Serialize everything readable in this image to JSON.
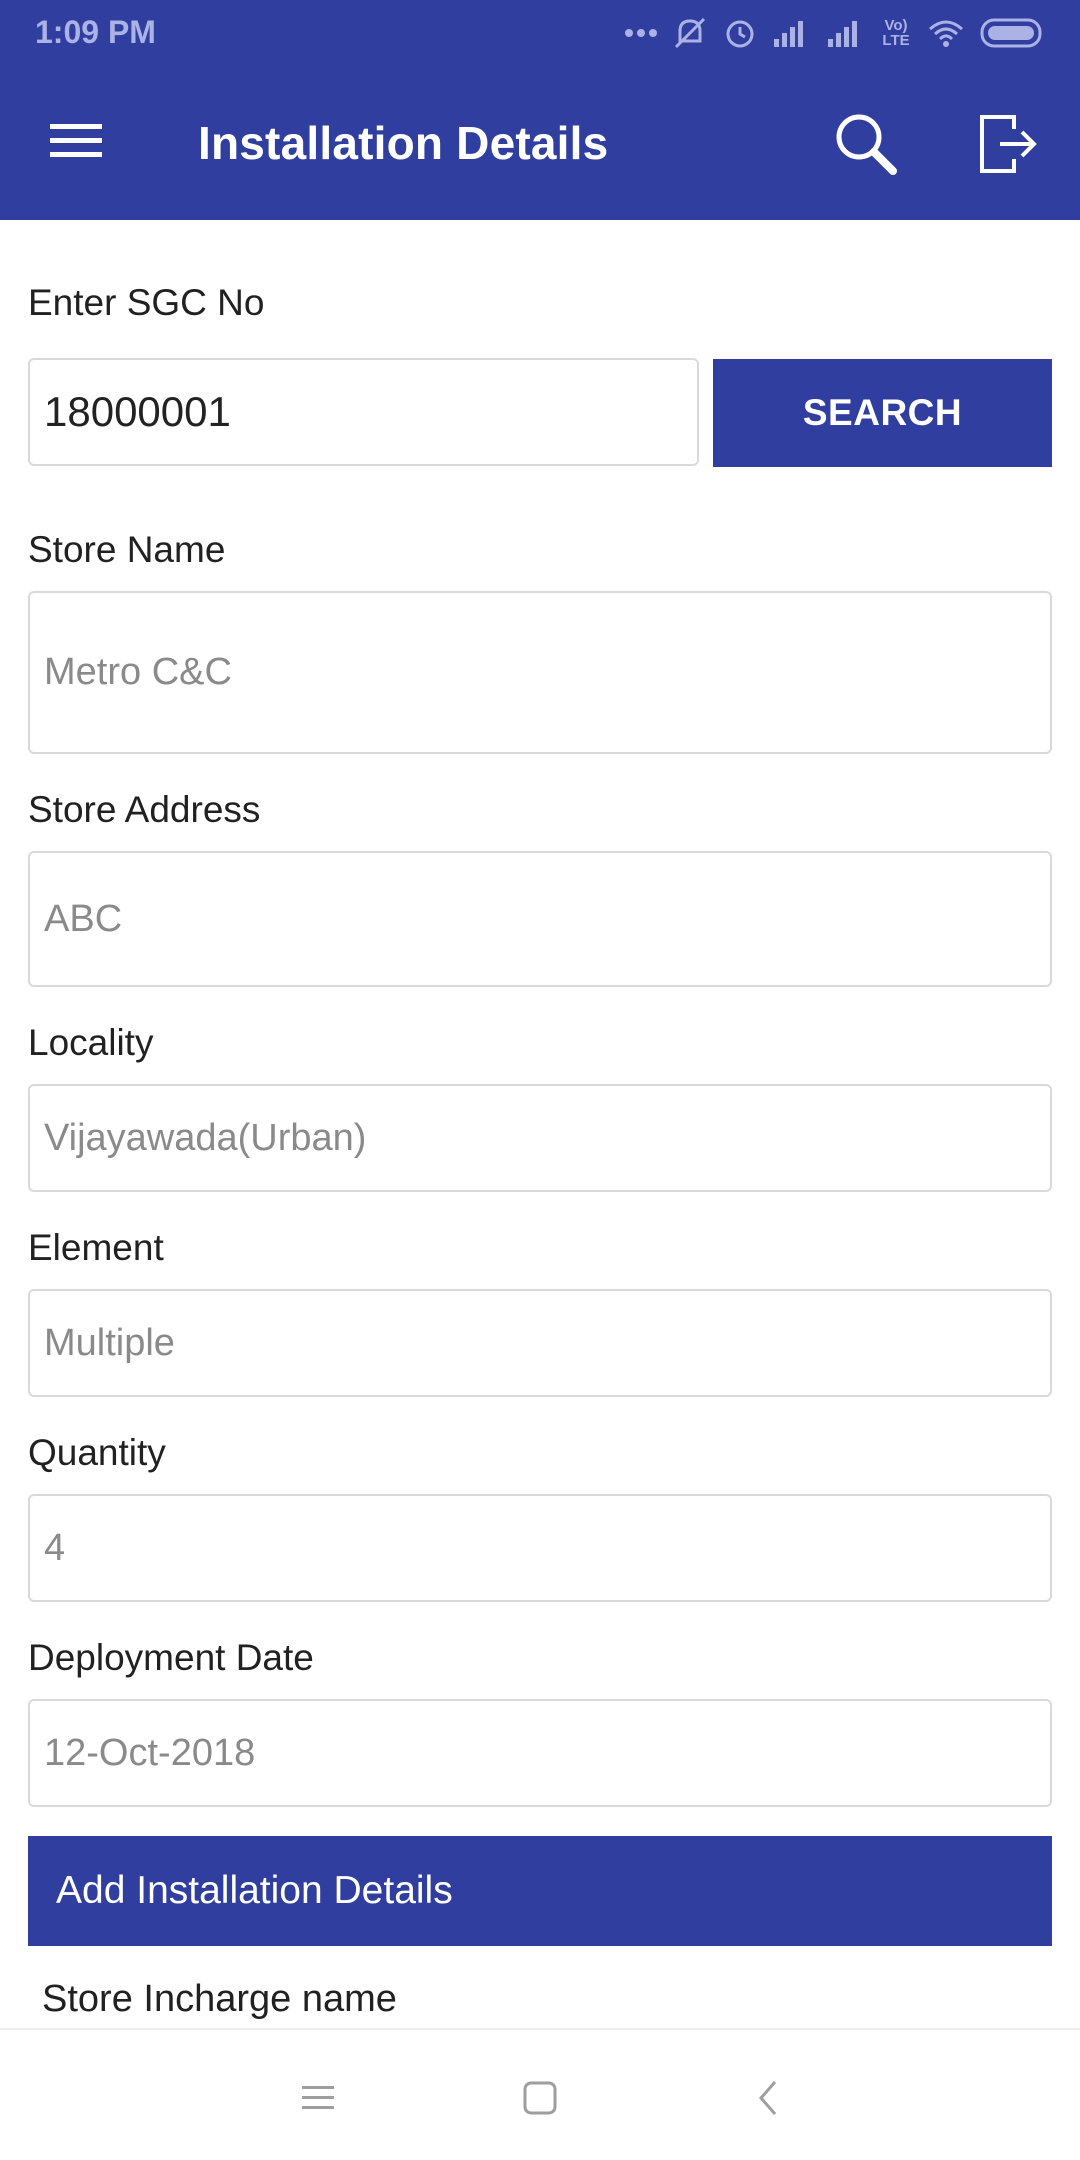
{
  "status_bar": {
    "time": "1:09 PM",
    "network_label": "Vo) LTE",
    "icons": [
      "more-dots-icon",
      "mute-icon",
      "alarm-icon",
      "signal-icon",
      "signal-icon",
      "volte-icon",
      "wifi-icon",
      "battery-icon"
    ]
  },
  "app_bar": {
    "title": "Installation Details",
    "menu_icon": "hamburger-menu-icon",
    "search_icon": "search-icon",
    "logout_icon": "logout-icon"
  },
  "sgc": {
    "label": "Enter SGC No",
    "value": "18000001",
    "search_button": "SEARCH"
  },
  "fields": {
    "store_name": {
      "label": "Store Name",
      "value": "Metro C&C"
    },
    "store_address": {
      "label": "Store Address",
      "value": "ABC"
    },
    "locality": {
      "label": "Locality",
      "value": "Vijayawada(Urban)"
    },
    "element": {
      "label": "Element",
      "value": "Multiple"
    },
    "quantity": {
      "label": "Quantity",
      "value": "4"
    },
    "deployment_date": {
      "label": "Deployment Date",
      "value": "12-Oct-2018"
    }
  },
  "install_section": {
    "title": "Add Installation Details",
    "first_field_label": "Store Incharge name"
  },
  "nav_bar": {
    "icons": [
      "recents-icon",
      "home-icon",
      "back-icon"
    ]
  },
  "colors": {
    "brand": "#303f9f",
    "field_border": "#d9d9d9",
    "readonly_text": "#8a8a8a"
  }
}
